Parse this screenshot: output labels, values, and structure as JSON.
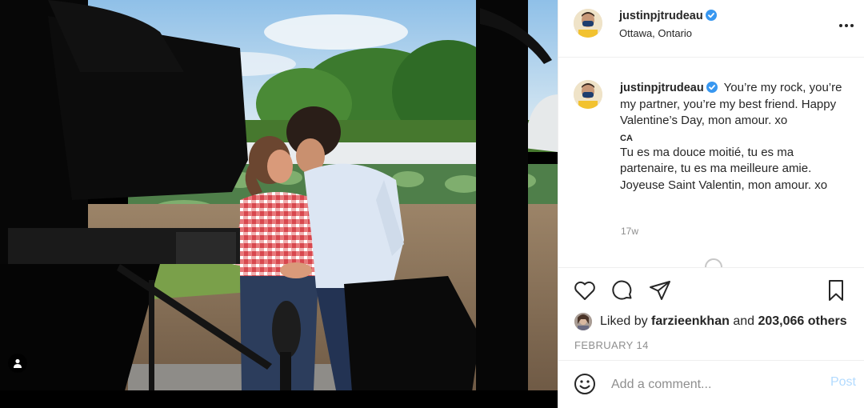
{
  "post": {
    "username": "justinpjtrudeau",
    "location": "Ottawa, Ontario",
    "image_alt": "Couple kissing in a farm field behind a camera rig",
    "verified": true
  },
  "caption": {
    "username": "justinpjtrudeau",
    "text": "You’re my rock, you’re my partner, you’re my best friend. Happy Valentine’s Day, mon amour. xo",
    "translation_label": "CA",
    "translation_text": "Tu es ma douce moitié, tu es ma partenaire, tu es ma meilleure amie. Joyeuse Saint Valentin, mon amour. xo",
    "time_ago": "17w"
  },
  "likes": {
    "prefix": "Liked by",
    "user": "farzieenkhan",
    "middle": "and",
    "others": "203,066 others"
  },
  "date": "FEBRUARY 14",
  "comment_box": {
    "placeholder": "Add a comment...",
    "post_label": "Post"
  },
  "colors": {
    "verified": "#3897f0",
    "muted": "#8e8e8e",
    "post_disabled": "#b3dbff"
  },
  "icons": {
    "more": "more-horizontal-icon",
    "like": "heart-icon",
    "comment": "comment-bubble-icon",
    "share": "paper-plane-icon",
    "save": "bookmark-icon",
    "emoji": "smiley-icon",
    "tag": "user-tag-icon"
  }
}
